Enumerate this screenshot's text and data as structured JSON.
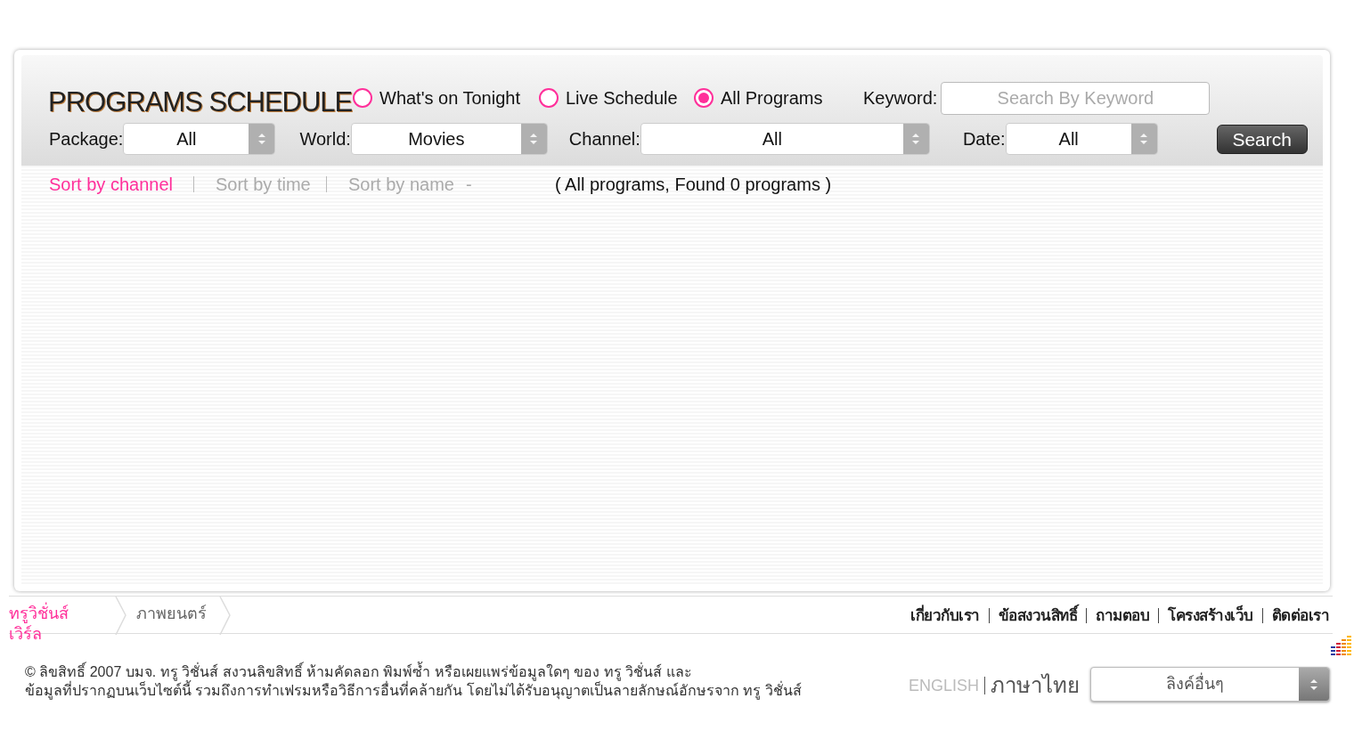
{
  "title": "PROGRAMS SCHEDULE",
  "modes": [
    {
      "label": "What's on Tonight",
      "selected": false
    },
    {
      "label": "Live Schedule",
      "selected": false
    },
    {
      "label": "All Programs",
      "selected": true
    }
  ],
  "keyword": {
    "label": "Keyword:",
    "placeholder": "Search By Keyword"
  },
  "filters": [
    {
      "label": "Package:",
      "value": "All"
    },
    {
      "label": "World:",
      "value": "Movies"
    },
    {
      "label": "Channel:",
      "value": "All"
    },
    {
      "label": "Date:",
      "value": "All"
    }
  ],
  "search_button": "Search",
  "sort_options": [
    {
      "label": "Sort by channel",
      "selected": true
    },
    {
      "label": "Sort by time",
      "selected": false
    },
    {
      "label": "Sort by name",
      "selected": false
    }
  ],
  "sort_trailing": "-",
  "result_summary": "( All programs, Found 0 programs )",
  "breadcrumb": [
    "ทรูวิชั่นส์ เวิร์ล",
    "ภาพยนตร์"
  ],
  "footer_links": [
    "เกี่ยวกับเรา",
    "ข้อสงวนสิทธิ์",
    "ถามตอบ",
    "โครงสร้างเว็บ",
    "ติดต่อเรา"
  ],
  "copyright": [
    "© ลิขสิทธิ์ 2007 บมจ. ทรู วิชั่นส์ สงวนลิขสิทธิ์ ห้ามคัดลอก พิมพ์ซ้ำ หรือเผยแพร่ข้อมูลใดๆ ของ ทรู วิชั่นส์ และ",
    "ข้อมูลที่ปรากฏบนเว็บไซต์นี้ รวมถึงการทำเฟรมหรือวิธีการอื่นที่คล้ายกัน โดยไม่ได้รับอนุญาตเป็นลายลักษณ์อักษรจาก ทรู วิชั่นส์"
  ],
  "languages": [
    {
      "label": "ENGLISH",
      "selected": false
    },
    {
      "label": "ภาษาไทย",
      "selected": true
    }
  ],
  "other_links": "ลิงค์อื่นๆ"
}
